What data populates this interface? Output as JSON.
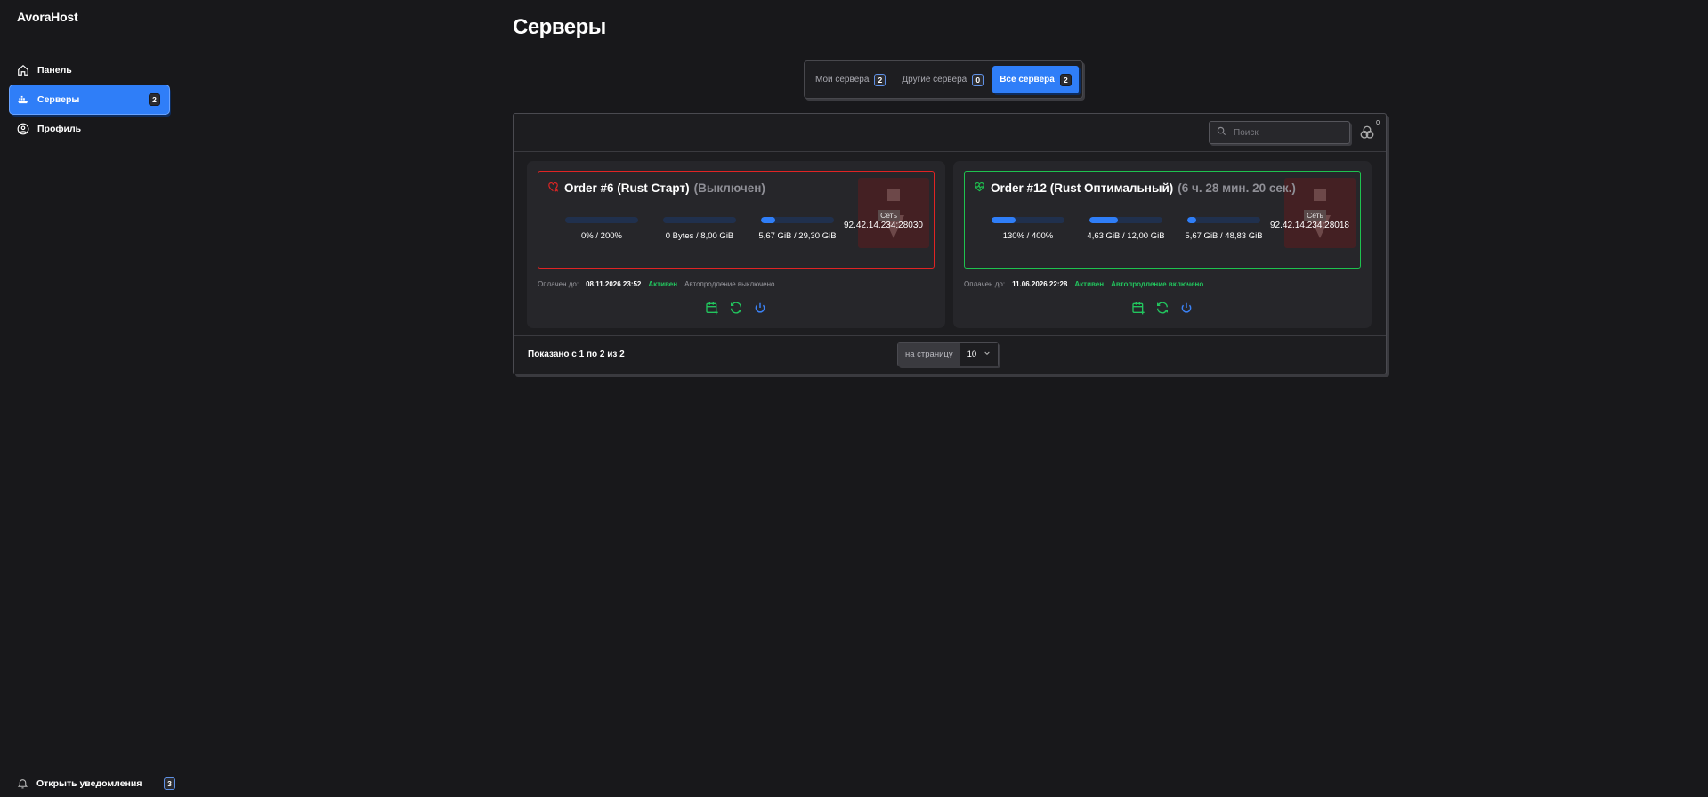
{
  "app": {
    "brand": "AvoraHost"
  },
  "sidebar": {
    "items": [
      {
        "label": "Панель",
        "icon": "home-icon"
      },
      {
        "label": "Серверы",
        "icon": "server-icon",
        "badge": "2",
        "active": true
      },
      {
        "label": "Профиль",
        "icon": "profile-icon"
      }
    ],
    "notifications": {
      "label": "Открыть уведомления",
      "count": "3"
    }
  },
  "page": {
    "title": "Серверы"
  },
  "tabs": [
    {
      "label": "Мои сервера",
      "count": "2"
    },
    {
      "label": "Другие сервера",
      "count": "0"
    },
    {
      "label": "Все сервера",
      "count": "2",
      "active": true
    }
  ],
  "toolbar": {
    "search_placeholder": "Поиск",
    "filter_count": "0"
  },
  "servers": [
    {
      "title": "Order #6 (Rust Старт)",
      "state": "(Выключен)",
      "status_color": "#e02424",
      "cpu": {
        "text": "0% / 200%",
        "fill": 0
      },
      "ram": {
        "text": "0 Bytes / 8,00 GiB",
        "fill": 0
      },
      "disk": {
        "text": "5,67 GiB / 29,30 GiB",
        "fill": 0.19
      },
      "net_label": "Сеть",
      "ip": "92.42.14.234:28030",
      "paid_label": "Оплачен до:",
      "paid_until": "08.11.2026 23:52",
      "status": "Активен",
      "autorenew": "Автопродление выключено"
    },
    {
      "title": "Order #12 (Rust Оптимальный)",
      "state": "(6 ч. 28 мин. 20 сек.)",
      "status_color": "#1ec24f",
      "cpu": {
        "text": "130% / 400%",
        "fill": 0.325
      },
      "ram": {
        "text": "4,63 GiB / 12,00 GiB",
        "fill": 0.386
      },
      "disk": {
        "text": "5,67 GiB / 48,83 GiB",
        "fill": 0.116
      },
      "net_label": "Сеть",
      "ip": "92.42.14.234:28018",
      "paid_label": "Оплачен до:",
      "paid_until": "11.06.2026 22:28",
      "status": "Активен",
      "autorenew": "Автопродление включено"
    }
  ],
  "pagination": {
    "shown": "Показано с 1 по 2 из 2",
    "per_page_label": "на страницу",
    "per_page_value": "10"
  }
}
